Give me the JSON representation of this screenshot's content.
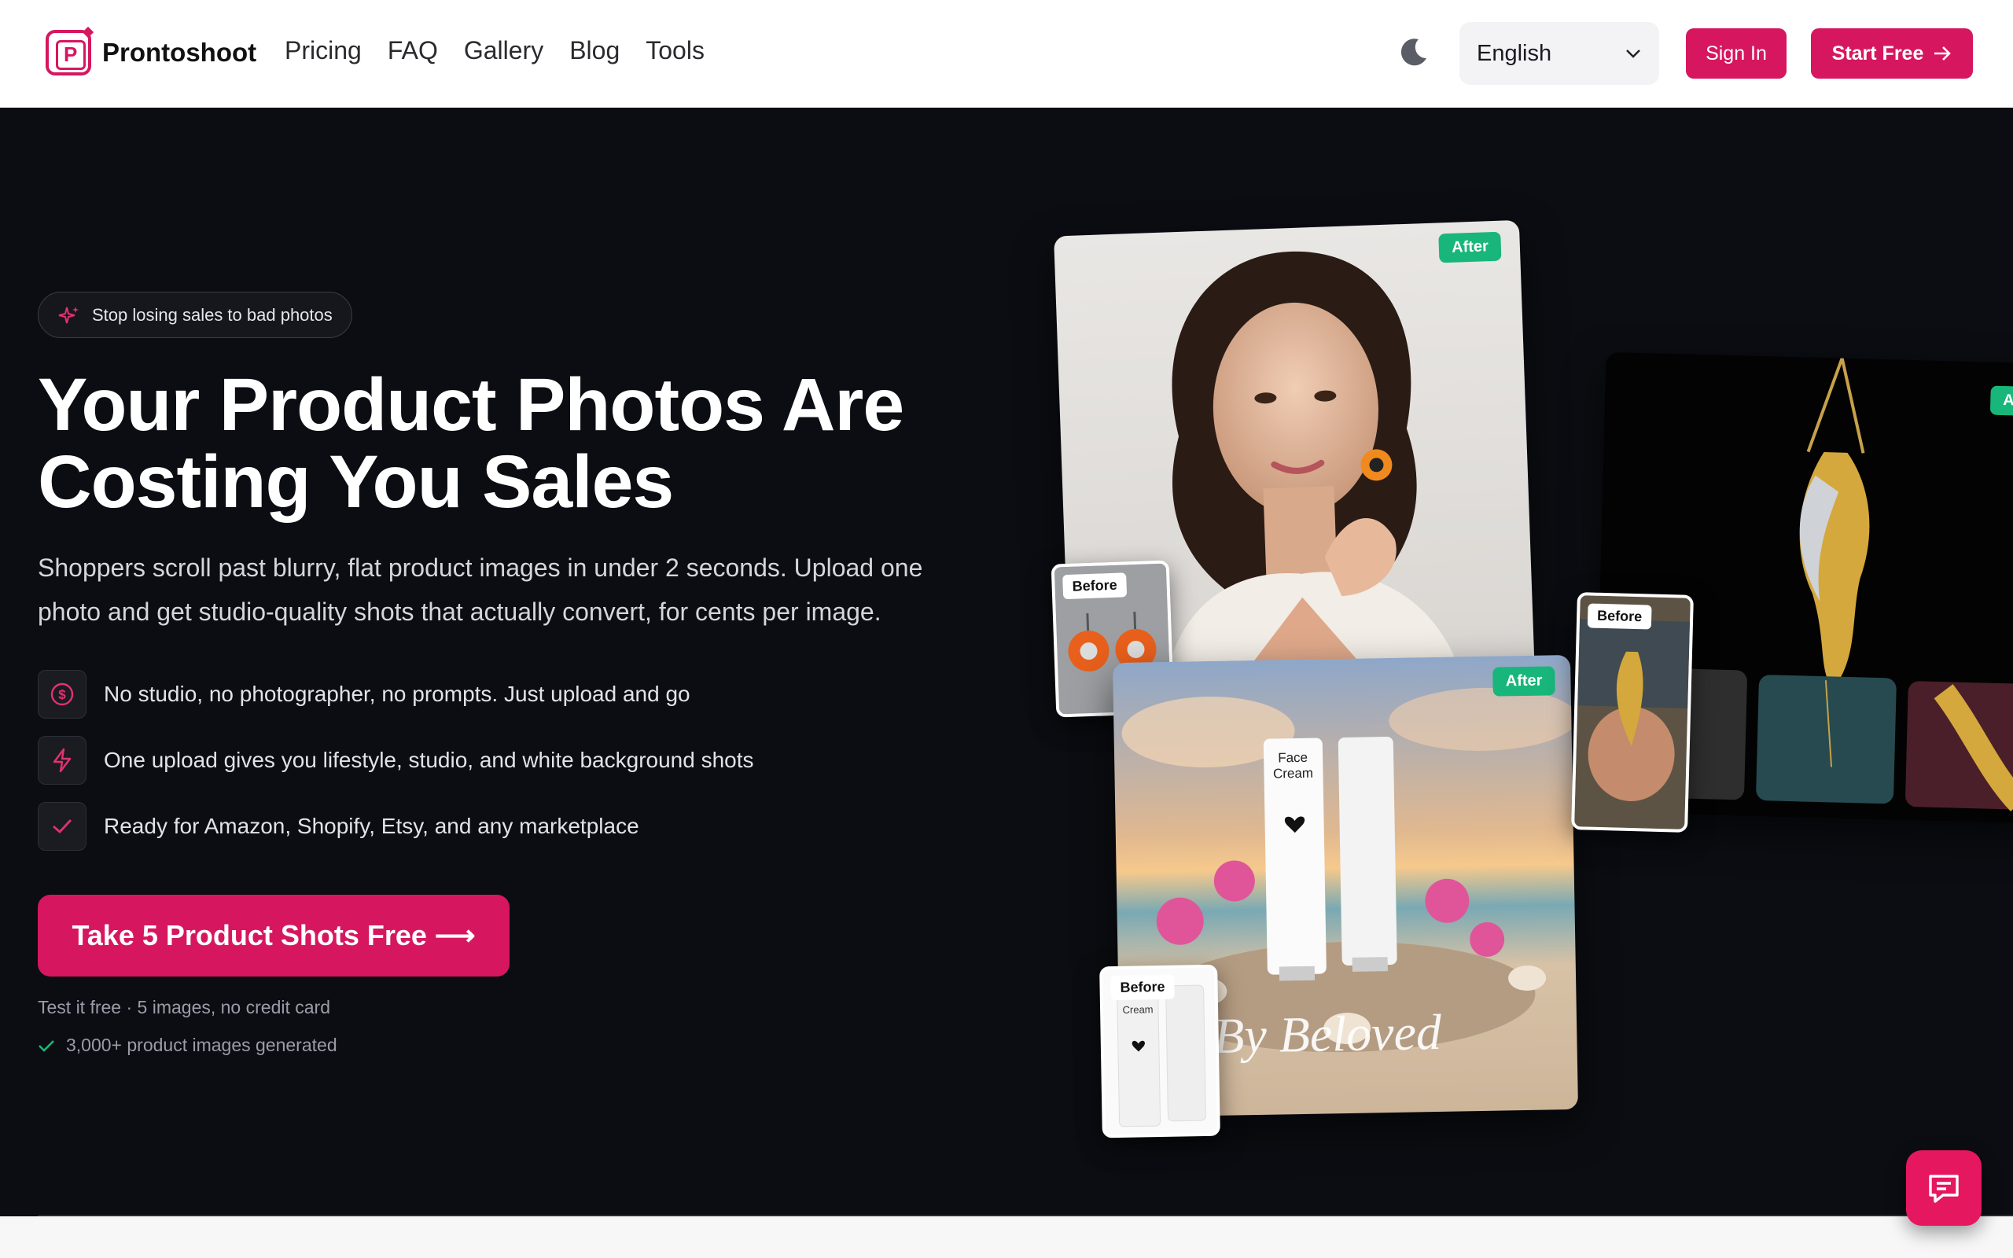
{
  "nav": {
    "brand": "Prontoshoot",
    "links": [
      "Pricing",
      "FAQ",
      "Gallery",
      "Blog",
      "Tools"
    ],
    "language": "English",
    "sign_in": "Sign In",
    "start_free": "Start Free"
  },
  "hero": {
    "badge": "Stop losing sales to bad photos",
    "headline": "Your Product Photos Are Costing You Sales",
    "subheadline": "Shoppers scroll past blurry, flat product images in under 2 seconds. Upload one photo and get studio-quality shots that actually convert, for cents per image.",
    "features": [
      {
        "icon": "dollar-circle-icon",
        "text": "No studio, no photographer, no prompts. Just upload and go"
      },
      {
        "icon": "lightning-icon",
        "text": "One upload gives you lifestyle, studio, and white background shots"
      },
      {
        "icon": "check-icon",
        "text": "Ready for Amazon, Shopify, Etsy, and any marketplace"
      }
    ],
    "cta": "Take 5 Product Shots Free ⟶",
    "note": "Test it free · 5 images, no credit card",
    "social_proof": "3,000+ product images generated"
  },
  "gallery": {
    "after_label": "After",
    "after_label_cut": "Af",
    "before_label": "Before",
    "product_title": "Face Cream",
    "watermark": "By Beloved",
    "brand_mark": "beloved",
    "small_product_label": "Cream"
  },
  "colors": {
    "accent": "#d6175f",
    "after_tag": "#18b67a",
    "hero_bg": "#0b0d12"
  }
}
